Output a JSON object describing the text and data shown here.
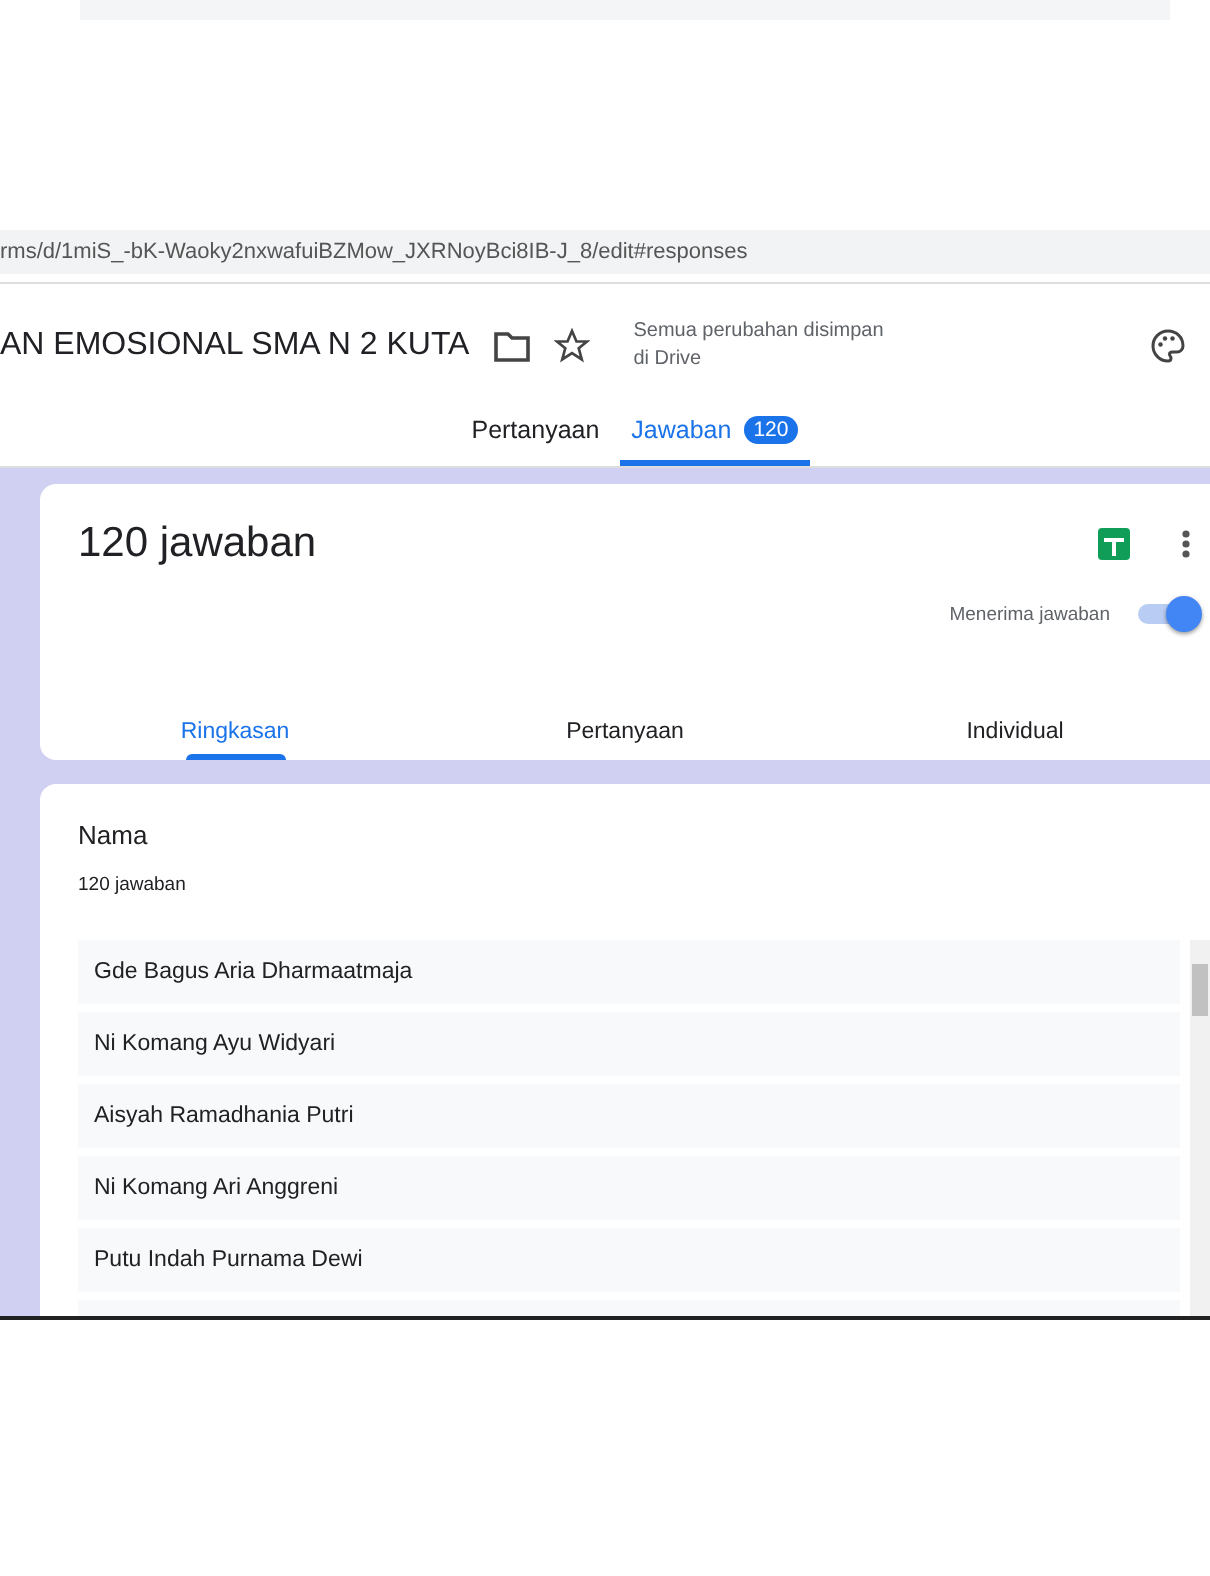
{
  "address_bar": {
    "url": "rms/d/1miS_-bK-Waoky2nxwafuiBZMow_JXRNoyBci8IB-J_8/edit#responses"
  },
  "header": {
    "title": "AN EMOSIONAL SMA N 2 KUTA",
    "save_status": "Semua perubahan disimpan di Drive"
  },
  "tabs": [
    {
      "label": "Pertanyaan",
      "selected": false
    },
    {
      "label": "Jawaban",
      "selected": true,
      "badge": "120"
    }
  ],
  "summary_card": {
    "title": "120 jawaban",
    "accepting_label": "Menerima jawaban",
    "accepting": true
  },
  "subtabs": [
    {
      "label": "Ringkasan",
      "selected": true
    },
    {
      "label": "Pertanyaan",
      "selected": false
    },
    {
      "label": "Individual",
      "selected": false
    }
  ],
  "question_card": {
    "title": "Nama",
    "count": "120 jawaban",
    "answers": [
      "Gde Bagus Aria Dharmaatmaja",
      "Ni Komang Ayu Widyari",
      "Aisyah Ramadhania Putri",
      "Ni Komang Ari Anggreni",
      "Putu Indah Purnama Dewi"
    ]
  }
}
